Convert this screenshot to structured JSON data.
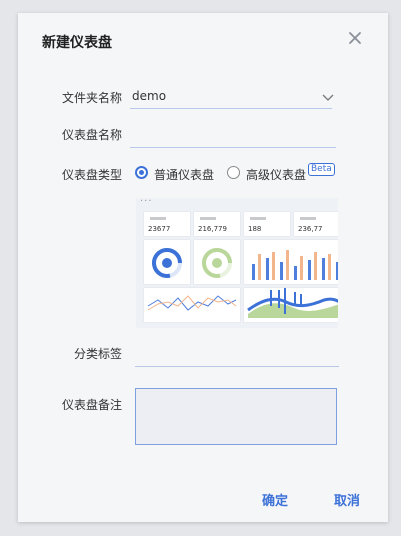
{
  "dialog": {
    "title": "新建仪表盘",
    "close_icon": "close-icon"
  },
  "form": {
    "folder": {
      "label": "文件夹名称",
      "value": "demo"
    },
    "name": {
      "label": "仪表盘名称",
      "value": ""
    },
    "type": {
      "label": "仪表盘类型",
      "options": [
        {
          "label": "普通仪表盘",
          "selected": true
        },
        {
          "label": "高级仪表盘",
          "selected": false,
          "badge": "Beta"
        }
      ]
    },
    "preview": {
      "menu": "···",
      "kpis": [
        "23677",
        "216,779",
        "188",
        "236,77"
      ]
    },
    "tags": {
      "label": "分类标签",
      "value": ""
    },
    "remark": {
      "label": "仪表盘备注",
      "value": ""
    }
  },
  "footer": {
    "confirm": "确定",
    "cancel": "取消"
  },
  "colors": {
    "accent": "#3c72d8",
    "orange": "#f2b58c",
    "green": "#b9d79a"
  }
}
